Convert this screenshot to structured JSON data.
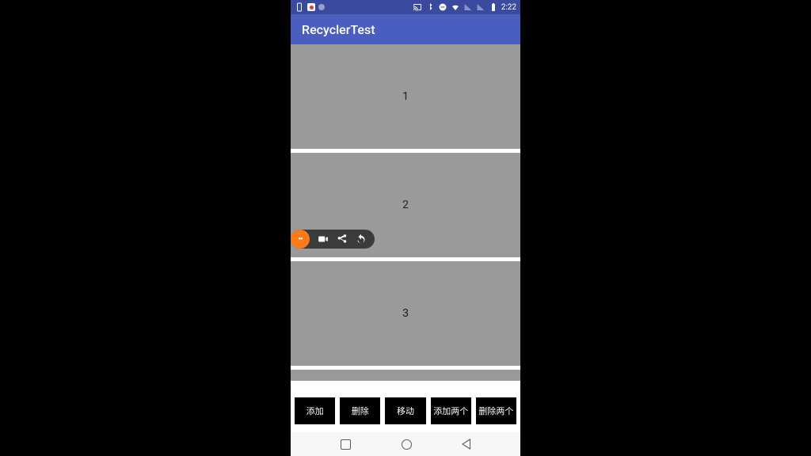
{
  "status": {
    "time": "2:22"
  },
  "appbar": {
    "title": "RecyclerTest"
  },
  "list": {
    "items": [
      "1",
      "2",
      "3"
    ]
  },
  "buttons": {
    "add": "添加",
    "remove": "删除",
    "move": "移动",
    "add_two": "添加两个",
    "remove_two": "删除两个"
  }
}
